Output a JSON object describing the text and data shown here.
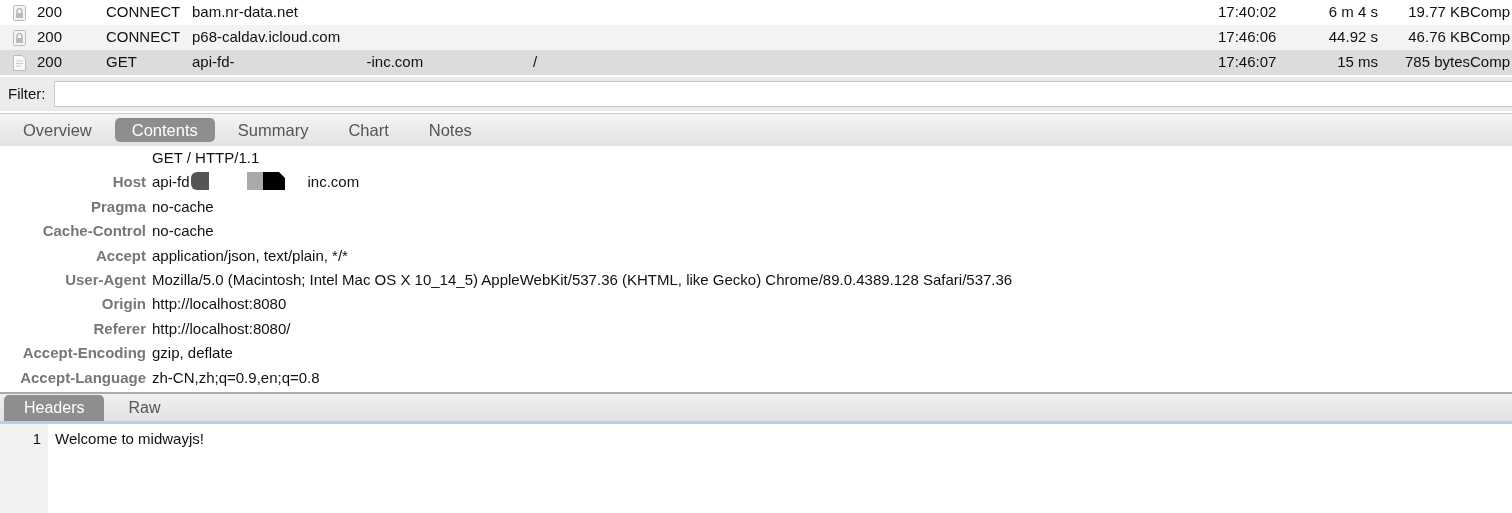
{
  "sessions": [
    {
      "kind": "tunnel",
      "status": "200",
      "method": "CONNECT",
      "host": [
        "bam.nr-data.net"
      ],
      "time": "17:40:02",
      "duration": "6 m 4 s",
      "size": "19.77 KB",
      "state": "Comp",
      "selected": false
    },
    {
      "kind": "tunnel",
      "status": "200",
      "method": "CONNECT",
      "host": [
        "p68-caldav.icloud.com"
      ],
      "time": "17:46:06",
      "duration": "44.92 s",
      "size": "46.76 KB",
      "state": "Comp",
      "selected": false
    },
    {
      "kind": "request",
      "status": "200",
      "method": "GET",
      "host": [
        "api-fd-",
        "-inc.com"
      ],
      "path": "/",
      "time": "17:46:07",
      "duration": "15 ms",
      "size": "785 bytes",
      "state": "Comp",
      "selected": true
    }
  ],
  "filter": {
    "label": "Filter:"
  },
  "tabs": [
    {
      "label": "Overview",
      "selected": false
    },
    {
      "label": "Contents",
      "selected": true
    },
    {
      "label": "Summary",
      "selected": false
    },
    {
      "label": "Chart",
      "selected": false
    },
    {
      "label": "Notes",
      "selected": false
    }
  ],
  "request_line": "GET / HTTP/1.1",
  "headers": [
    {
      "name": "Host",
      "value": [
        "api-fd",
        "inc.com"
      ]
    },
    {
      "name": "Pragma",
      "value": [
        "no-cache"
      ]
    },
    {
      "name": "Cache-Control",
      "value": [
        "no-cache"
      ]
    },
    {
      "name": "Accept",
      "value": [
        "application/json, text/plain, */*"
      ]
    },
    {
      "name": "User-Agent",
      "value": [
        "Mozilla/5.0 (Macintosh; Intel Mac OS X 10_14_5) AppleWebKit/537.36 (KHTML, like Gecko) Chrome/89.0.4389.128 Safari/537.36"
      ]
    },
    {
      "name": "Origin",
      "value": [
        "http://localhost:8080"
      ]
    },
    {
      "name": "Referer",
      "value": [
        "http://localhost:8080/"
      ]
    },
    {
      "name": "Accept-Encoding",
      "value": [
        "gzip, deflate"
      ]
    },
    {
      "name": "Accept-Language",
      "value": [
        "zh-CN,zh;q=0.9,en;q=0.8"
      ]
    }
  ],
  "bottom_tabs": [
    {
      "label": "Headers",
      "selected": true
    },
    {
      "label": "Raw",
      "selected": false
    }
  ],
  "body_lines": [
    {
      "number": "1",
      "text": "Welcome to midwayjs!"
    }
  ]
}
